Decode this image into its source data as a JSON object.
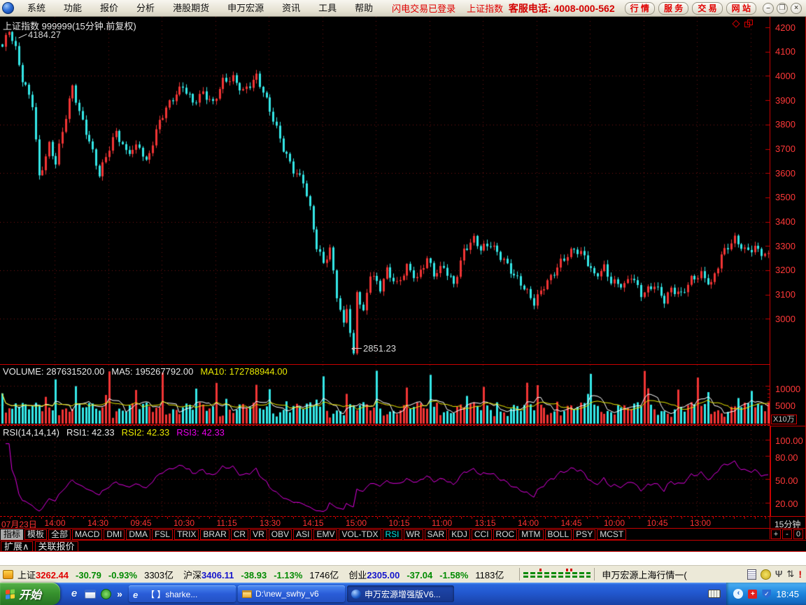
{
  "menu_bar": {
    "items": [
      "系统",
      "功能",
      "报价",
      "分析",
      "港股期货",
      "申万宏源",
      "资讯",
      "工具",
      "帮助"
    ],
    "flash_trade_status": "闪电交易已登录",
    "current_symbol": "上证指数",
    "service_phone": "客服电话: 4008-000-562",
    "buttons": [
      "行 情",
      "服 务",
      "交 易",
      "网 站"
    ],
    "window_controls": {
      "minimize": "–",
      "restore": "❐",
      "close": "×"
    }
  },
  "chart": {
    "title": "上证指数 999999(15分钟.前复权)",
    "high_annotation": "4184.27",
    "low_annotation": "2851.23",
    "price_axis": [
      "4200",
      "4100",
      "4000",
      "3900",
      "3800",
      "3700",
      "3600",
      "3500",
      "3400",
      "3300",
      "3200",
      "3100",
      "3000"
    ],
    "colors": {
      "up": "#f23535",
      "down": "#35e8e8",
      "axis": "#c80000",
      "grid": "#7a1212",
      "day_line": "#6e1010",
      "ma5": "#ffffff",
      "ma10": "#e8e800",
      "rsi_line": "#e000e0"
    }
  },
  "volume_panel": {
    "label_volume": "VOLUME: 287631520.00",
    "label_ma5": "MA5: 195267792.00",
    "label_ma10": "MA10: 172788944.00",
    "axis_ticks": [
      "10000",
      "5000"
    ],
    "unit_label": "X10万"
  },
  "rsi_panel": {
    "label_params": "RSI(14,14,14)",
    "label_rsi1": "RSI1: 42.33",
    "label_rsi2": "RSI2: 42.33",
    "label_rsi3": "RSI3: 42.33",
    "axis_ticks": [
      "100.00",
      "80.00",
      "50.00",
      "20.00"
    ]
  },
  "time_axis": {
    "labels": [
      "07月23日",
      "14:00",
      "14:30",
      "09:45",
      "10:30",
      "11:15",
      "13:30",
      "14:15",
      "15:00",
      "10:15",
      "11:00",
      "13:15",
      "14:00",
      "14:45",
      "10:00",
      "10:45",
      "13:00"
    ],
    "period_label": "15分钟"
  },
  "indicator_bar": {
    "tabs": [
      {
        "label": "指标",
        "cls": "selected"
      },
      {
        "label": "模板"
      },
      {
        "label": "全部"
      },
      {
        "label": "MACD"
      },
      {
        "label": "DMI"
      },
      {
        "label": "DMA"
      },
      {
        "label": "FSL"
      },
      {
        "label": "TRIX"
      },
      {
        "label": "BRAR"
      },
      {
        "label": "CR"
      },
      {
        "label": "VR"
      },
      {
        "label": "OBV"
      },
      {
        "label": "ASI"
      },
      {
        "label": "EMV"
      },
      {
        "label": "VOL-TDX"
      },
      {
        "label": "RSI",
        "cls": "active"
      },
      {
        "label": "WR"
      },
      {
        "label": "SAR"
      },
      {
        "label": "KDJ"
      },
      {
        "label": "CCI"
      },
      {
        "label": "ROC"
      },
      {
        "label": "MTM"
      },
      {
        "label": "BOLL"
      },
      {
        "label": "PSY"
      },
      {
        "label": "MCST"
      }
    ],
    "zoom_buttons": [
      "+",
      "-",
      "0"
    ]
  },
  "extension_bar": {
    "tabs": [
      "扩展∧",
      "关联报价"
    ]
  },
  "status_bar": {
    "indices": [
      {
        "name": "上证",
        "price": "3262.44",
        "price_cls": "red",
        "change": "-30.79",
        "pct": "-0.93%",
        "amount": "3303亿"
      },
      {
        "name": "沪深",
        "price": "3406.11",
        "price_cls": "blue",
        "change": "-38.93",
        "pct": "-1.13%",
        "amount": "1746亿"
      },
      {
        "name": "创业",
        "price": "2305.00",
        "price_cls": "blue",
        "change": "-37.04",
        "pct": "-1.58%",
        "amount": "1183亿"
      }
    ],
    "connection_label": "申万宏源上海行情一("
  },
  "taskbar": {
    "start_label": "开始",
    "tasks": [
      {
        "title": "【 】sharke...",
        "icon": "ie"
      },
      {
        "title": "D:\\new_swhy_v6",
        "icon": "folder"
      },
      {
        "title": "申万宏源增强版V6...",
        "icon": "swhy",
        "cls": "active"
      }
    ],
    "clock": "18:45"
  },
  "chart_data": {
    "type": "candlestick",
    "symbol": "上证指数 999999",
    "interval": "15分钟",
    "adjust": "前复权",
    "visible_high": 4184.27,
    "visible_low": 2851.23,
    "last_close": 3262.44,
    "price_axis_ticks": [
      4200,
      4100,
      4000,
      3900,
      3800,
      3700,
      3600,
      3500,
      3400,
      3300,
      3200,
      3100,
      3000
    ],
    "grid_levels": [
      4000,
      3800,
      3600,
      3400,
      3200,
      3000
    ],
    "volume_axis_ticks": [
      10000,
      5000
    ],
    "volume_unit_multiplier": 100000,
    "volume_latest": 287631520.0,
    "volume_ma5": 195267792.0,
    "volume_ma10": 172788944.0,
    "rsi_params": [
      14,
      14,
      14
    ],
    "rsi_values": {
      "rsi1": 42.33,
      "rsi2": 42.33,
      "rsi3": 42.33
    },
    "rsi_axis_ticks": [
      100,
      80,
      50,
      20
    ],
    "candle_count": 230,
    "candles_per_day": 16,
    "x_step": 4.78,
    "close_path_anchors": [
      [
        0,
        4120
      ],
      [
        2,
        4184
      ],
      [
        4,
        4100
      ],
      [
        6,
        3980
      ],
      [
        9,
        3890
      ],
      [
        11,
        3590
      ],
      [
        14,
        3720
      ],
      [
        16,
        3640
      ],
      [
        21,
        3950
      ],
      [
        23,
        3850
      ],
      [
        26,
        3740
      ],
      [
        29,
        3600
      ],
      [
        32,
        3700
      ],
      [
        34,
        3760
      ],
      [
        37,
        3680
      ],
      [
        41,
        3720
      ],
      [
        43,
        3650
      ],
      [
        47,
        3810
      ],
      [
        50,
        3880
      ],
      [
        54,
        3960
      ],
      [
        57,
        3900
      ],
      [
        60,
        3935
      ],
      [
        63,
        3880
      ],
      [
        66,
        3970
      ],
      [
        69,
        3990
      ],
      [
        72,
        3945
      ],
      [
        76,
        4000
      ],
      [
        78,
        3930
      ],
      [
        80,
        3850
      ],
      [
        84,
        3700
      ],
      [
        87,
        3620
      ],
      [
        90,
        3575
      ],
      [
        92,
        3450
      ],
      [
        94,
        3290
      ],
      [
        96,
        3220
      ],
      [
        98,
        3280
      ],
      [
        100,
        3100
      ],
      [
        102,
        2980
      ],
      [
        103,
        3060
      ],
      [
        105,
        2851
      ],
      [
        106,
        3120
      ],
      [
        108,
        3020
      ],
      [
        110,
        3180
      ],
      [
        113,
        3120
      ],
      [
        115,
        3200
      ],
      [
        118,
        3150
      ],
      [
        121,
        3220
      ],
      [
        124,
        3160
      ],
      [
        127,
        3240
      ],
      [
        129,
        3180
      ],
      [
        132,
        3220
      ],
      [
        135,
        3150
      ],
      [
        138,
        3280
      ],
      [
        141,
        3320
      ],
      [
        143,
        3280
      ],
      [
        146,
        3310
      ],
      [
        150,
        3250
      ],
      [
        153,
        3180
      ],
      [
        156,
        3120
      ],
      [
        159,
        3060
      ],
      [
        162,
        3140
      ],
      [
        165,
        3200
      ],
      [
        167,
        3240
      ],
      [
        171,
        3280
      ],
      [
        174,
        3250
      ],
      [
        177,
        3180
      ],
      [
        180,
        3220
      ],
      [
        182,
        3160
      ],
      [
        186,
        3130
      ],
      [
        188,
        3170
      ],
      [
        191,
        3100
      ],
      [
        195,
        3150
      ],
      [
        198,
        3080
      ],
      [
        200,
        3120
      ],
      [
        203,
        3090
      ],
      [
        206,
        3160
      ],
      [
        209,
        3190
      ],
      [
        212,
        3150
      ],
      [
        215,
        3260
      ],
      [
        219,
        3320
      ],
      [
        222,
        3280
      ],
      [
        225,
        3300
      ],
      [
        229,
        3262
      ]
    ]
  }
}
